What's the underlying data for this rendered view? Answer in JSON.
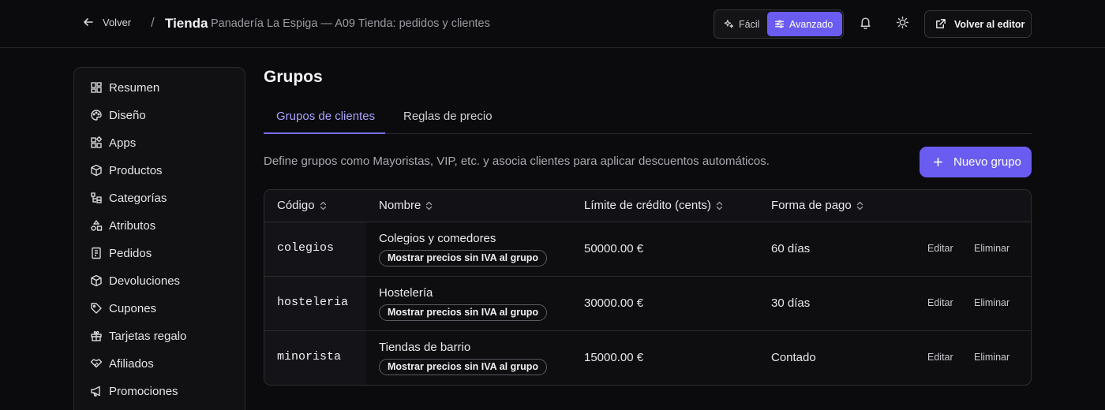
{
  "header": {
    "back_label": "Volver",
    "separator": "/",
    "store_title": "Tienda",
    "store_subtitle": "Panadería La Espiga — A09 Tienda: pedidos y clientes",
    "mode_easy": "Fácil",
    "mode_advanced": "Avanzado",
    "editor_button": "Volver al editor"
  },
  "sidebar": {
    "items": [
      {
        "label": "Resumen",
        "icon": "dashboard-icon"
      },
      {
        "label": "Diseño",
        "icon": "palette-icon"
      },
      {
        "label": "Apps",
        "icon": "apps-icon"
      },
      {
        "label": "Productos",
        "icon": "box-icon"
      },
      {
        "label": "Categorías",
        "icon": "categories-icon"
      },
      {
        "label": "Atributos",
        "icon": "shapes-icon"
      },
      {
        "label": "Pedidos",
        "icon": "receipt-icon"
      },
      {
        "label": "Devoluciones",
        "icon": "return-box-icon"
      },
      {
        "label": "Cupones",
        "icon": "tag-icon"
      },
      {
        "label": "Tarjetas regalo",
        "icon": "gift-icon"
      },
      {
        "label": "Afiliados",
        "icon": "handshake-icon"
      },
      {
        "label": "Promociones",
        "icon": "megaphone-icon"
      }
    ]
  },
  "main": {
    "title": "Grupos",
    "tabs": [
      {
        "label": "Grupos de clientes",
        "active": true
      },
      {
        "label": "Reglas de precio",
        "active": false
      }
    ],
    "description": "Define grupos como Mayoristas, VIP, etc. y asocia clientes para aplicar descuentos automáticos.",
    "new_button": "Nuevo grupo",
    "table": {
      "columns": [
        "Código",
        "Nombre",
        "Límite de crédito (cents)",
        "Forma de pago"
      ],
      "rows": [
        {
          "code": "colegios",
          "name": "Colegios y comedores",
          "badge": "Mostrar precios sin IVA al grupo",
          "credit": "50000.00 €",
          "payment": "60 días",
          "edit": "Editar",
          "delete": "Eliminar"
        },
        {
          "code": "hosteleria",
          "name": "Hostelería",
          "badge": "Mostrar precios sin IVA al grupo",
          "credit": "30000.00 €",
          "payment": "30 días",
          "edit": "Editar",
          "delete": "Eliminar"
        },
        {
          "code": "minorista",
          "name": "Tiendas de barrio",
          "badge": "Mostrar precios sin IVA al grupo",
          "credit": "15000.00 €",
          "payment": "Contado",
          "edit": "Editar",
          "delete": "Eliminar"
        }
      ]
    }
  },
  "colors": {
    "background": "#0b0b0d",
    "accent": "#6a5cf0",
    "active_tab": "#a9a3ff"
  }
}
